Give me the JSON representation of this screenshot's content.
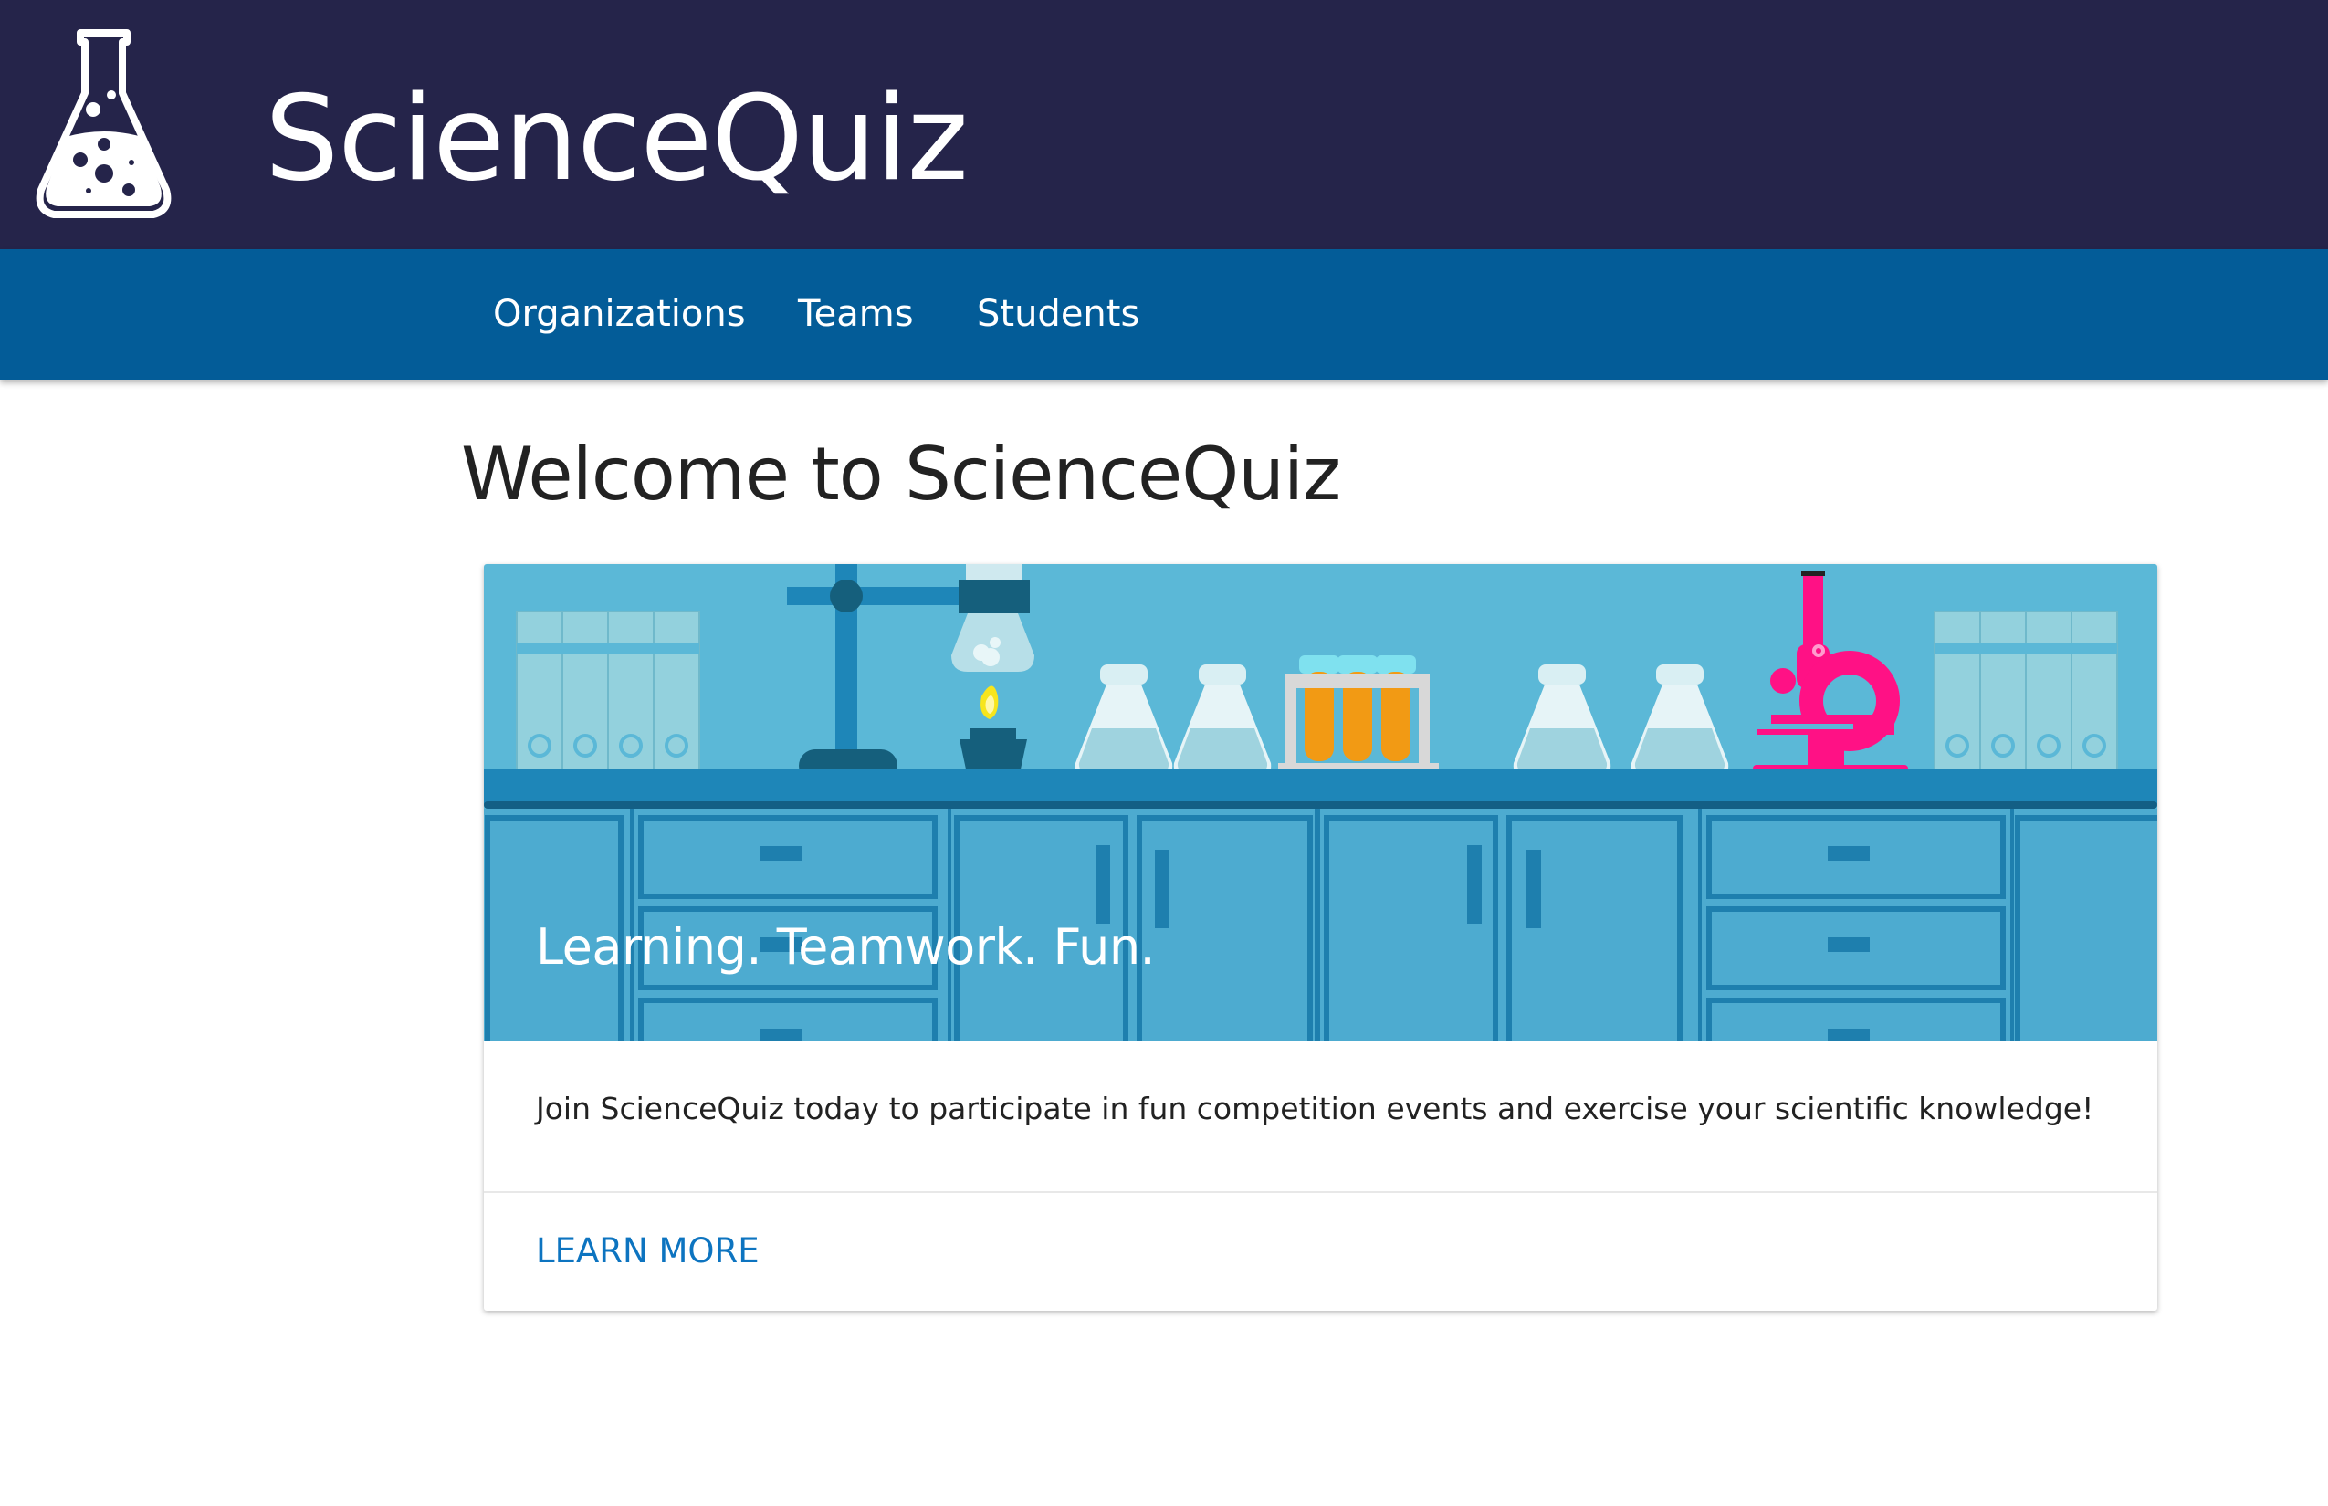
{
  "header": {
    "logo_icon": "flask-icon",
    "title": "ScienceQuiz",
    "background_color": "#25244a"
  },
  "nav": {
    "background_color": "#035c98",
    "items": [
      {
        "label": "Organizations"
      },
      {
        "label": "Teams"
      },
      {
        "label": "Students"
      }
    ]
  },
  "main": {
    "title": "Welcome to ScienceQuiz",
    "card": {
      "image": "laboratory-illustration",
      "caption": "Learning. Teamwork. Fun.",
      "body": "Join ScienceQuiz today to participate in fun competition events and exercise your scientific knowledge!",
      "action_label": "LEARN MORE",
      "action_color": "#0d74c0"
    }
  }
}
